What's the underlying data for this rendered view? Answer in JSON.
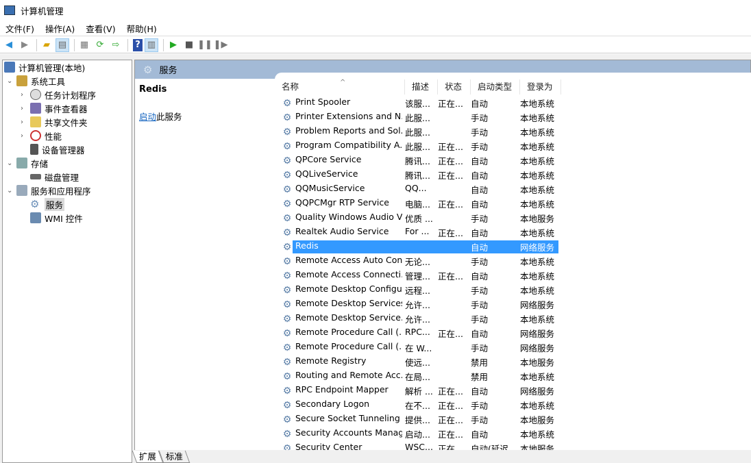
{
  "window": {
    "title": "计算机管理"
  },
  "menu": [
    "文件(F)",
    "操作(A)",
    "查看(V)",
    "帮助(H)"
  ],
  "toolbar": {
    "icons": [
      "back-icon",
      "forward-icon",
      "up-folder-icon",
      "show-hide-tree-icon",
      "properties-icon",
      "refresh-icon",
      "export-icon",
      "help-icon",
      "action-pane-icon",
      "start-icon",
      "stop-icon",
      "pause-icon",
      "resume-icon"
    ]
  },
  "tree": [
    {
      "label": "计算机管理(本地)",
      "level": 0
    },
    {
      "label": "系统工具",
      "level": 1,
      "expanded": true
    },
    {
      "label": "任务计划程序",
      "level": 2
    },
    {
      "label": "事件查看器",
      "level": 2
    },
    {
      "label": "共享文件夹",
      "level": 2
    },
    {
      "label": "性能",
      "level": 2
    },
    {
      "label": "设备管理器",
      "level": 2
    },
    {
      "label": "存储",
      "level": 1,
      "expanded": true
    },
    {
      "label": "磁盘管理",
      "level": 2
    },
    {
      "label": "服务和应用程序",
      "level": 1,
      "expanded": true
    },
    {
      "label": "服务",
      "level": 2,
      "selected": true
    },
    {
      "label": "WMI 控件",
      "level": 2
    }
  ],
  "panel": {
    "title": "服务",
    "selected_service": "Redis",
    "action_link": "启动",
    "action_rest": "此服务"
  },
  "columns": [
    "名称",
    "描述",
    "状态",
    "启动类型",
    "登录为"
  ],
  "rows": [
    [
      "Print Spooler",
      "该服...",
      "正在...",
      "自动",
      "本地系统"
    ],
    [
      "Printer Extensions and N...",
      "此服...",
      "",
      "手动",
      "本地系统"
    ],
    [
      "Problem Reports and Sol...",
      "此服...",
      "",
      "手动",
      "本地系统"
    ],
    [
      "Program Compatibility A...",
      "此服...",
      "正在...",
      "手动",
      "本地系统"
    ],
    [
      "QPCore Service",
      "腾讯...",
      "正在...",
      "自动",
      "本地系统"
    ],
    [
      "QQLiveService",
      "腾讯...",
      "正在...",
      "自动",
      "本地系统"
    ],
    [
      "QQMusicService",
      "QQ...",
      "",
      "自动",
      "本地系统"
    ],
    [
      "QQPCMgr RTP Service",
      "电脑...",
      "正在...",
      "自动",
      "本地系统"
    ],
    [
      "Quality Windows Audio V...",
      "优质 ...",
      "",
      "手动",
      "本地服务"
    ],
    [
      "Realtek Audio Service",
      "For ...",
      "正在...",
      "自动",
      "本地系统"
    ],
    [
      "Redis",
      "",
      "",
      "自动",
      "网络服务"
    ],
    [
      "Remote Access Auto Con...",
      "无论...",
      "",
      "手动",
      "本地系统"
    ],
    [
      "Remote Access Connecti...",
      "管理...",
      "正在...",
      "自动",
      "本地系统"
    ],
    [
      "Remote Desktop Configu...",
      "远程...",
      "",
      "手动",
      "本地系统"
    ],
    [
      "Remote Desktop Services",
      "允许...",
      "",
      "手动",
      "网络服务"
    ],
    [
      "Remote Desktop Service...",
      "允许...",
      "",
      "手动",
      "本地系统"
    ],
    [
      "Remote Procedure Call (...",
      "RPC...",
      "正在...",
      "自动",
      "网络服务"
    ],
    [
      "Remote Procedure Call (...",
      "在 W...",
      "",
      "手动",
      "网络服务"
    ],
    [
      "Remote Registry",
      "使远...",
      "",
      "禁用",
      "本地服务"
    ],
    [
      "Routing and Remote Acc...",
      "在局...",
      "",
      "禁用",
      "本地系统"
    ],
    [
      "RPC Endpoint Mapper",
      "解析 ...",
      "正在...",
      "自动",
      "网络服务"
    ],
    [
      "Secondary Logon",
      "在不...",
      "正在...",
      "手动",
      "本地系统"
    ],
    [
      "Secure Socket Tunneling ...",
      "提供...",
      "正在...",
      "手动",
      "本地服务"
    ],
    [
      "Security Accounts Manag...",
      "启动...",
      "正在...",
      "自动",
      "本地系统"
    ],
    [
      "Security Center",
      "WSC...",
      "正在...",
      "自动(延迟...",
      "本地服务"
    ]
  ],
  "selected_row": 10,
  "tabs": [
    "扩展",
    "标准"
  ],
  "colors": {
    "header": "#a3bad6",
    "selection": "#3399ff",
    "link": "#1565c0"
  }
}
